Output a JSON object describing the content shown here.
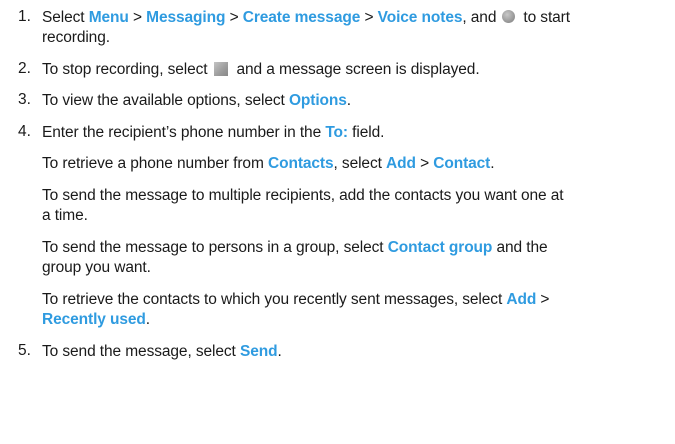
{
  "steps": [
    {
      "number": "1."
    },
    {
      "number": "2."
    },
    {
      "number": "3."
    },
    {
      "number": "4."
    },
    {
      "number": "5."
    }
  ],
  "step1": {
    "text_a": "Select ",
    "menu": "Menu",
    "sep1": " > ",
    "messaging": "Messaging",
    "sep2": " > ",
    "create_message": "Create message",
    "sep3": " > ",
    "voice_notes": "Voice notes",
    "text_b": ", and",
    "text_c": "to start",
    "line2": "recording.",
    "icon": "record-icon"
  },
  "step2": {
    "text_a": "To stop recording, select",
    "text_b": "and a message screen is displayed.",
    "icon": "stop-icon"
  },
  "step3": {
    "text_a": "To view the available options, select ",
    "options": "Options",
    "text_b": "."
  },
  "step4": {
    "text_a": "Enter the recipient’s phone number in the ",
    "to_field": "To:",
    "text_b": " field.",
    "p1_a": "To retrieve a phone number from ",
    "contacts": "Contacts",
    "p1_b": ", select ",
    "add": "Add",
    "p1_sep": " > ",
    "contact": "Contact",
    "p1_c": ".",
    "p2_line1": "To send the message to multiple recipients, add the contacts you want one at",
    "p2_line2": "a time.",
    "p3_a": "To send the message to persons in a group, select ",
    "contact_group": "Contact group",
    "p3_b": " and the",
    "p3_line2": "group you want.",
    "p4_a": "To retrieve the contacts to which you recently sent messages, select ",
    "add2": "Add",
    "p4_sep": " >",
    "recently_used": "Recently used",
    "p4_b": "."
  },
  "step5": {
    "text_a": "To send the message, select ",
    "send": "Send",
    "text_b": "."
  },
  "colors": {
    "highlight": "#2f9be0",
    "text": "#1a1a1a"
  }
}
